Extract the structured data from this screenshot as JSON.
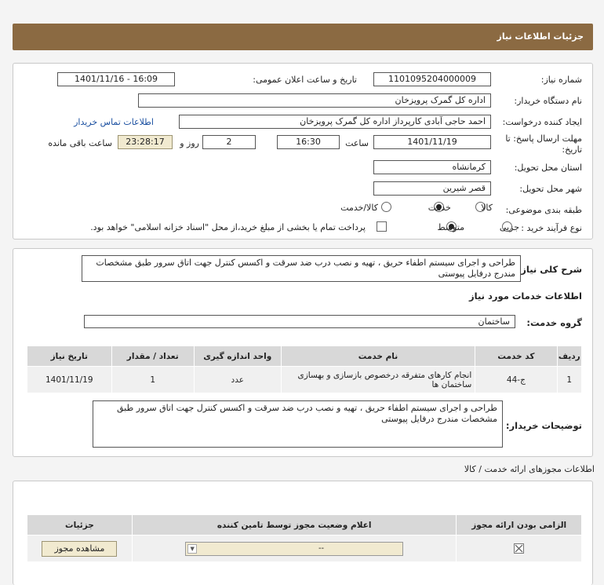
{
  "header": {
    "title": "جزئیات اطلاعات نیاز"
  },
  "form": {
    "need_number_label": "شماره نیاز:",
    "need_number": "1101095204000009",
    "announce_label": "تاریخ و ساعت اعلان عمومی:",
    "announce_value": "1401/11/16 - 16:09",
    "buyer_org_label": "نام دستگاه خریدار:",
    "buyer_org": "اداره کل گمرک پرویزخان",
    "requester_label": "ایجاد کننده درخواست:",
    "requester": "احمد حاجی آبادی کارپرداز اداره کل گمرک پرویزخان",
    "contact_link": "اطلاعات تماس خریدار",
    "deadline_label_1": "مهلت ارسال پاسخ: تا",
    "deadline_label_2": "تاریخ:",
    "deadline_date": "1401/11/19",
    "time_label": "ساعت",
    "deadline_time": "16:30",
    "days_value": "2",
    "days_label": "روز و",
    "remaining_time": "23:28:17",
    "remaining_label": "ساعت باقی مانده",
    "province_label": "استان محل تحویل:",
    "province": "کرمانشاه",
    "city_label": "شهر محل تحویل:",
    "city": "قصر شیرین",
    "category_label": "طبقه بندی موضوعی:",
    "category_options": [
      "کالا",
      "خدمت",
      "کالا/خدمت"
    ],
    "category_selected": "خدمت",
    "process_label": "نوع فرآیند خرید :",
    "process_options": [
      "جزیی",
      "متوسط"
    ],
    "process_selected": "متوسط",
    "payment_note": "پرداخت تمام یا بخشی از مبلغ خرید،از محل \"اسناد خزانه اسلامی\" خواهد بود."
  },
  "summary": {
    "label": "شرح کلی نیاز:",
    "text": "طراحی و اجرای سیستم اطفاء حریق ، تهیه و نصب درب ضد سرقت و اکسس کنترل جهت اتاق سرور طبق مشخصات مندرج درفایل پیوستی"
  },
  "services": {
    "section_title": "اطلاعات خدمات مورد نیاز",
    "group_label": "گروه خدمت:",
    "group_value": "ساختمان",
    "columns": [
      "ردیف",
      "کد خدمت",
      "نام خدمت",
      "واحد اندازه گیری",
      "تعداد / مقدار",
      "تاریخ نیاز"
    ],
    "rows": [
      {
        "row": "1",
        "code": "ج-44",
        "name": "انجام کارهای متفرقه درخصوص بازسازی و بهسازی ساختمان ها",
        "unit": "عدد",
        "qty": "1",
        "date": "1401/11/19"
      }
    ]
  },
  "buyer_notes": {
    "label": "توضیحات خریدار:",
    "text": "طراحی و اجرای سیستم اطفاء حریق ، تهیه و نصب درب ضد سرقت و اکسس کنترل جهت اتاق سرور طبق مشخصات مندرج درفایل پیوستی"
  },
  "permits": {
    "section_title": "اطلاعات مجوزهای ارائه خدمت / کالا",
    "columns": [
      "الزامی بودن ارائه مجوز",
      "اعلام وضعیت مجوز توسط تامین کننده",
      "جزئیات"
    ],
    "select_value": "--",
    "view_button": "مشاهده مجوز"
  },
  "watermark": {
    "text": "ParsNamadData"
  },
  "colors": {
    "header_bg": "#8b6a42",
    "link": "#1a4fa0",
    "button_bg": "#f1ead0"
  }
}
